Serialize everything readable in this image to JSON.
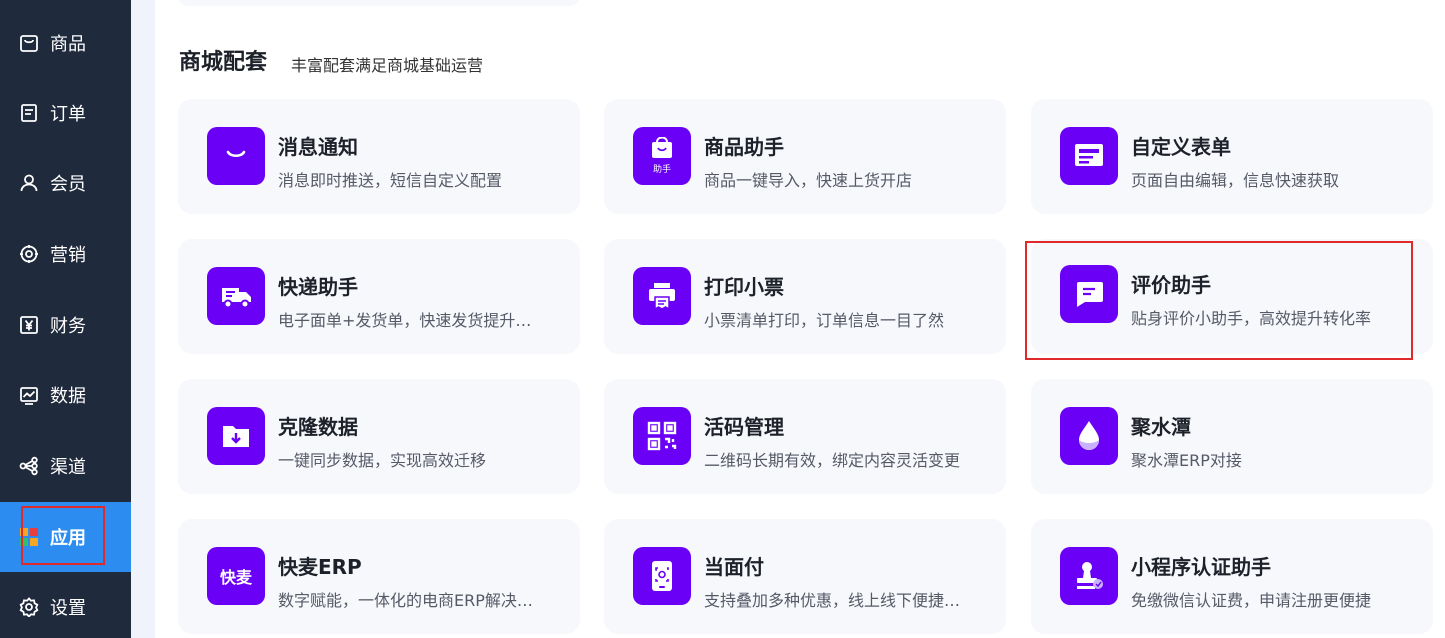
{
  "sidebar": {
    "items": [
      {
        "label": "商品",
        "icon": "bag-icon"
      },
      {
        "label": "订单",
        "icon": "document-icon"
      },
      {
        "label": "会员",
        "icon": "user-icon"
      },
      {
        "label": "营销",
        "icon": "gear-badge-icon"
      },
      {
        "label": "财务",
        "icon": "yen-icon"
      },
      {
        "label": "数据",
        "icon": "chart-icon"
      },
      {
        "label": "渠道",
        "icon": "share-icon"
      },
      {
        "label": "应用",
        "icon": "apps-icon",
        "active": true
      },
      {
        "label": "设置",
        "icon": "settings-icon"
      }
    ]
  },
  "section": {
    "title": "商城配套",
    "subtitle": "丰富配套满足商城基础运营"
  },
  "cards": [
    {
      "title": "消息通知",
      "desc": "消息即时推送，短信自定义配置",
      "icon": "message-smile-icon"
    },
    {
      "title": "商品助手",
      "desc": "商品一键导入，快速上货开店",
      "icon": "shopping-bag-helper-icon",
      "icon_text": "助手"
    },
    {
      "title": "自定义表单",
      "desc": "页面自由编辑，信息快速获取",
      "icon": "form-icon"
    },
    {
      "title": "快递助手",
      "desc": "电子面单+发货单，快速发货提升效率",
      "icon": "delivery-truck-icon"
    },
    {
      "title": "打印小票",
      "desc": "小票清单打印，订单信息一目了然",
      "icon": "printer-icon"
    },
    {
      "title": "评价助手",
      "desc": "贴身评价小助手，高效提升转化率",
      "icon": "comment-icon"
    },
    {
      "title": "克隆数据",
      "desc": "一键同步数据，实现高效迁移",
      "icon": "folder-download-icon"
    },
    {
      "title": "活码管理",
      "desc": "二维码长期有效，绑定内容灵活变更",
      "icon": "qr-code-icon"
    },
    {
      "title": "聚水潭",
      "desc": "聚水潭ERP对接",
      "icon": "water-drop-icon"
    },
    {
      "title": "快麦ERP",
      "desc": "数字赋能，一体化的电商ERP解决方案",
      "icon": "kuaimai-logo-icon",
      "icon_text": "快麦"
    },
    {
      "title": "当面付",
      "desc": "支持叠加多种优惠，线上线下便捷收款",
      "icon": "phone-scan-icon"
    },
    {
      "title": "小程序认证助手",
      "desc": "免缴微信认证费，申请注册更便捷",
      "icon": "certification-stamp-icon"
    }
  ],
  "colors": {
    "sidebar_bg": "#1f2a3c",
    "sidebar_active": "#2d8cf0",
    "icon_bg": "#6a00f5",
    "card_bg": "#f7f8fc",
    "highlight": "#e0292b"
  }
}
